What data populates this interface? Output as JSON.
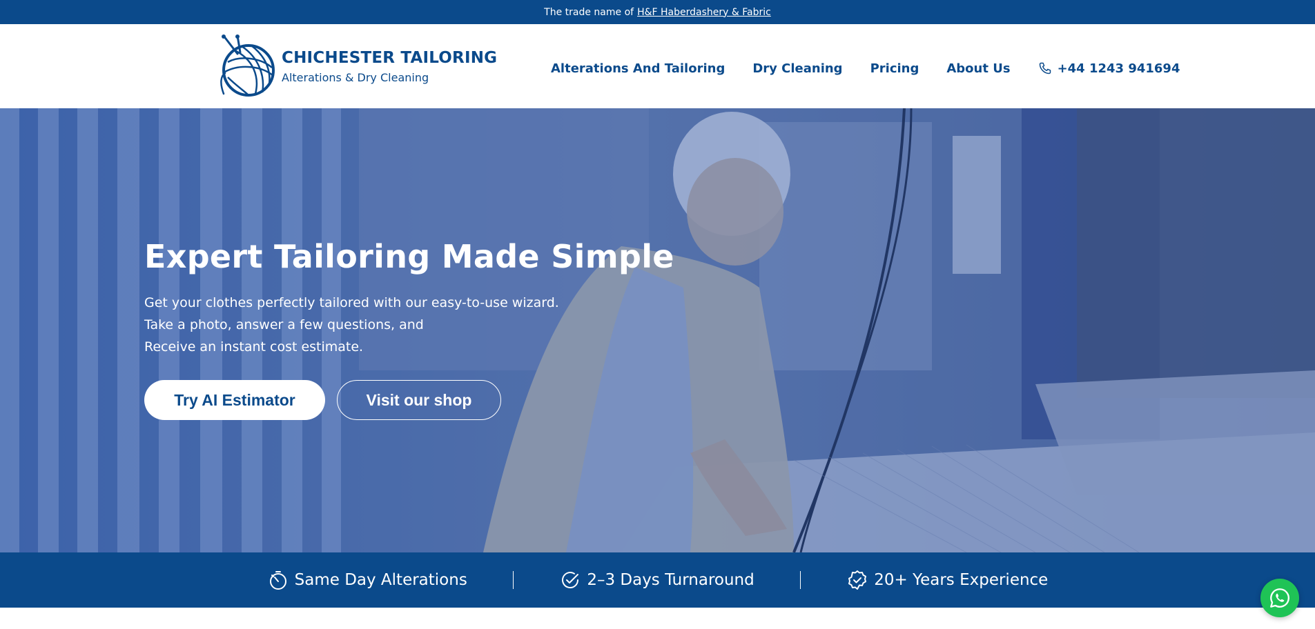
{
  "topbar": {
    "text": "The trade name of",
    "link": "H&F Haberdashery & Fabric"
  },
  "brand": {
    "name": "CHICHESTER TAILORING",
    "tagline": "Alterations & Dry Cleaning",
    "icon": "yarn-ball-icon"
  },
  "nav": {
    "items": [
      {
        "label": "Alterations And Tailoring"
      },
      {
        "label": "Dry Cleaning"
      },
      {
        "label": "Pricing"
      },
      {
        "label": "About Us"
      }
    ],
    "phone": "+44 1243 941694",
    "phone_icon": "phone-icon"
  },
  "hero": {
    "title": "Expert Tailoring Made Simple",
    "lines": [
      "Get your clothes perfectly tailored with our easy-to-use wizard.",
      "Take a photo, answer a few questions, and",
      "Receive an instant cost estimate."
    ],
    "primary_button": "Try AI Estimator",
    "secondary_button": "Visit our shop"
  },
  "features": [
    {
      "label": "Same Day Alterations",
      "icon": "stopwatch-icon"
    },
    {
      "label": "2–3 Days Turnaround",
      "icon": "clock-check-icon"
    },
    {
      "label": "20+ Years Experience",
      "icon": "badge-check-icon"
    }
  ],
  "whatsapp": {
    "icon": "whatsapp-icon"
  },
  "colors": {
    "brand_blue": "#0b4a8b",
    "whatsapp_green": "#1fc356",
    "white": "#ffffff"
  }
}
